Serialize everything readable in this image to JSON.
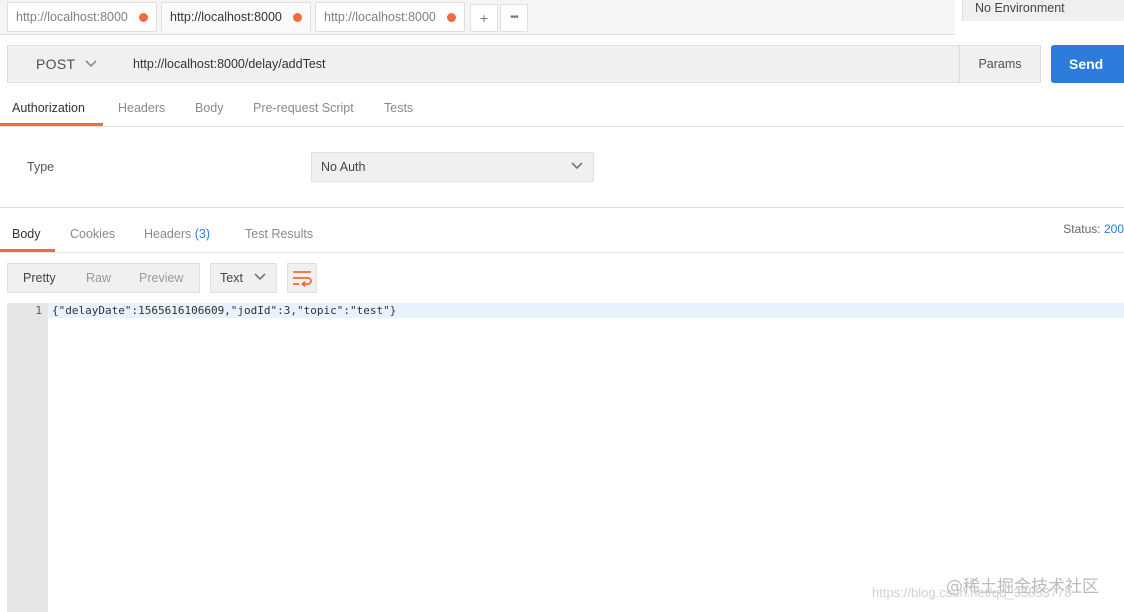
{
  "tabs": [
    {
      "label": "http://localhost:8000"
    },
    {
      "label": "http://localhost:8000"
    },
    {
      "label": "http://localhost:8000"
    }
  ],
  "tab_controls": {
    "add": "+",
    "more": "•••"
  },
  "environment": {
    "selected": "No Environment"
  },
  "request": {
    "method": "POST",
    "url": "http://localhost:8000/delay/addTest",
    "params_label": "Params",
    "send_label": "Send"
  },
  "request_tabs": [
    "Authorization",
    "Headers",
    "Body",
    "Pre-request Script",
    "Tests"
  ],
  "auth": {
    "type_label": "Type",
    "type_value": "No Auth"
  },
  "response_tabs": {
    "body": "Body",
    "cookies": "Cookies",
    "headers": "Headers",
    "headers_count": "(3)",
    "test_results": "Test Results"
  },
  "status": {
    "label": "Status:",
    "code": "200"
  },
  "view_modes": [
    "Pretty",
    "Raw",
    "Preview"
  ],
  "format": {
    "selected": "Text"
  },
  "response_body": {
    "line_number": "1",
    "content": "{\"delayDate\":1565616106609,\"jodId\":3,\"topic\":\"test\"}"
  },
  "watermark": {
    "brand": "@稀土掘金技术社区",
    "source": "https://blog.csdn.net/qq_35853778"
  },
  "colors": {
    "accent": "#f26b3a",
    "send": "#2d7bdb",
    "badge": "#2d7bdb"
  }
}
